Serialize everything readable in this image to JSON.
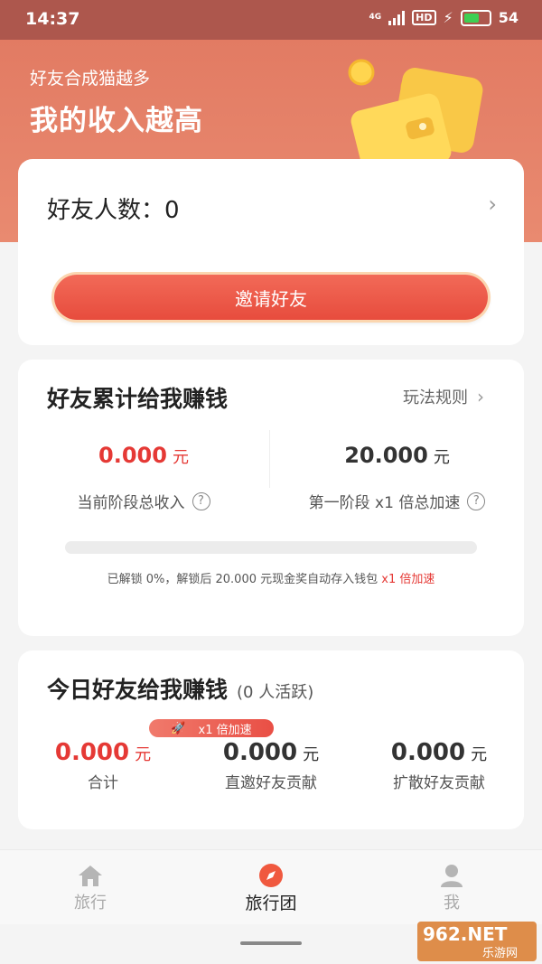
{
  "status_bar": {
    "time": "14:37",
    "network": "4G",
    "hd": "HD",
    "battery": "54"
  },
  "hero": {
    "subtitle": "好友合成猫越多",
    "title": "我的收入越高"
  },
  "friends_card": {
    "label": "好友人数：0",
    "invite_button": "邀请好友"
  },
  "cumulative": {
    "title": "好友累计给我赚钱",
    "rules_link": "玩法规则",
    "current_amount": "0.000",
    "current_unit": "元",
    "current_label": "当前阶段总收入",
    "stage_amount": "20.000",
    "stage_unit": "元",
    "stage_label": "第一阶段 x1 倍总加速",
    "unlock_text": "已解锁 0%，解锁后 20.000 元现金奖自动存入钱包",
    "unlock_highlight": "x1 倍加速",
    "progress_fraction": 0
  },
  "today": {
    "title": "今日好友给我赚钱",
    "active_note": "(0 人活跃)",
    "badge": "x1 倍加速",
    "stats": [
      {
        "amount": "0.000",
        "unit": "元",
        "label": "合计"
      },
      {
        "amount": "0.000",
        "unit": "元",
        "label": "直邀好友贡献"
      },
      {
        "amount": "0.000",
        "unit": "元",
        "label": "扩散好友贡献"
      }
    ]
  },
  "nav": [
    {
      "label": "旅行",
      "icon": "home-icon"
    },
    {
      "label": "旅行团",
      "icon": "compass-icon"
    },
    {
      "label": "我",
      "icon": "user-icon"
    }
  ],
  "watermark": {
    "brand": "962.NET",
    "site": "乐游网"
  },
  "colors": {
    "accent_red": "#e53935",
    "hero_top": "#e27b63",
    "status_bar": "#ad574d"
  }
}
